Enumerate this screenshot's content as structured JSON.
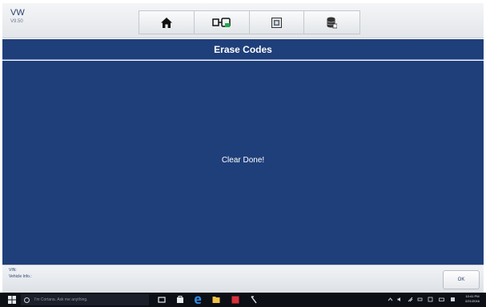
{
  "header": {
    "brand": "VW",
    "version": "V9.50",
    "toolbar": [
      {
        "icon": "home-icon"
      },
      {
        "icon": "vehicle-connect-icon"
      },
      {
        "icon": "screenshot-icon"
      },
      {
        "icon": "data-save-icon"
      }
    ]
  },
  "title": "Erase Codes",
  "main": {
    "message": "Clear Done!"
  },
  "footer": {
    "vin_label": "VIN:",
    "vehicle_info_label": "Vehicle Info.:",
    "ok_button": "OK"
  },
  "taskbar": {
    "search_placeholder": "I'm Cortana. Ask me anything.",
    "time": "10:41 PM",
    "date": "2/21/2016"
  },
  "colors": {
    "content_bg": "#1f3f7a",
    "header_bg": "#e9ebee",
    "taskbar_bg": "#0c0f16"
  }
}
